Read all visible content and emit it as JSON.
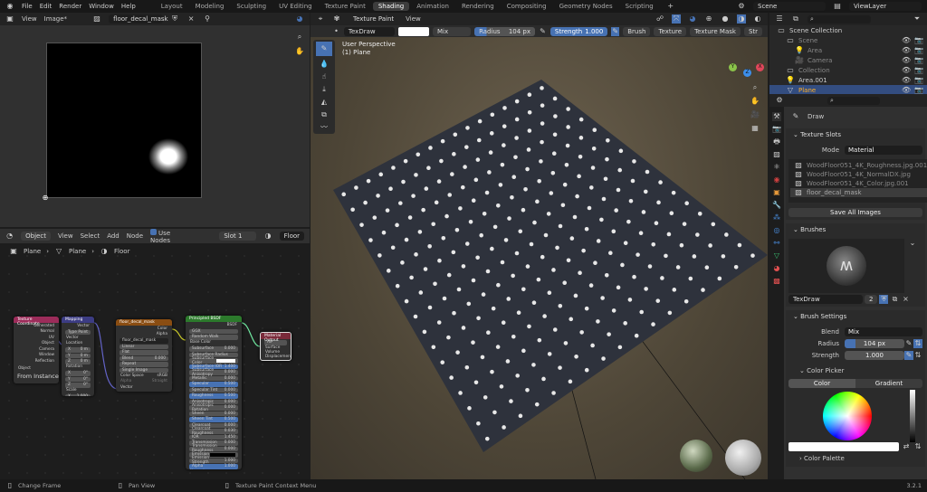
{
  "menu": {
    "items": [
      "File",
      "Edit",
      "Render",
      "Window",
      "Help"
    ]
  },
  "workspaces": [
    "Layout",
    "Modeling",
    "Sculpting",
    "UV Editing",
    "Texture Paint",
    "Shading",
    "Animation",
    "Rendering",
    "Compositing",
    "Geometry Nodes",
    "Scripting"
  ],
  "active_workspace": "Shading",
  "scene": "Scene",
  "view_layer": "ViewLayer",
  "image_editor": {
    "view": "View",
    "image_menu": "Image*",
    "image_name": "floor_decal_mask"
  },
  "viewport": {
    "mode": "Texture Paint",
    "view": "View",
    "brush_name": "TexDraw",
    "blend": "Mix",
    "radius_label": "Radius",
    "radius": "104 px",
    "radius_fraction": 0.2,
    "strength_label": "Strength",
    "strength": "1.000",
    "menus": [
      "Brush",
      "Texture",
      "Texture Mask",
      "Str"
    ],
    "perspective": "User Perspective",
    "object": "(1) Plane",
    "axes": {
      "x": "X",
      "y": "Y",
      "z": "Z"
    }
  },
  "node_editor": {
    "object_mode": "Object",
    "menus": [
      "View",
      "Select",
      "Add",
      "Node"
    ],
    "use_nodes": "Use Nodes",
    "slot": "Slot 1",
    "material": "Floor",
    "breadcrumb": [
      "Plane",
      "Plane",
      "Floor"
    ],
    "nodes": {
      "texcoord": {
        "title": "Texture Coordinate",
        "outputs": [
          "Generated",
          "Normal",
          "UV",
          "Object",
          "Camera",
          "Window",
          "Reflection"
        ],
        "object_label": "Object",
        "from_instancer": "From Instancer"
      },
      "mapping": {
        "title": "Mapping",
        "output": "Vector",
        "type_label": "Type",
        "type": "Point",
        "input": "Vector",
        "location": "Location",
        "rotation": "Rotation",
        "scale": "Scale",
        "loc": [
          "0 m",
          "0 m",
          "0 m"
        ],
        "rot": [
          "0°",
          "0°",
          "0°"
        ],
        "scl": [
          "1.000",
          "1.000",
          "1.000"
        ],
        "axes": [
          "X",
          "Y",
          "Z"
        ]
      },
      "image": {
        "title": "floor_decal_mask",
        "outputs": [
          "Color",
          "Alpha"
        ],
        "image": "floor_decal_mask",
        "interpolation": "Linear",
        "projection": "Flat",
        "blend_label": "Blend",
        "blend": "0.000",
        "extension": "Repeat",
        "source": "Single Image",
        "colorspace_label": "Color Space",
        "colorspace": "sRGB",
        "alpha_label": "Alpha",
        "alpha": "Straight",
        "input": "Vector"
      },
      "bsdf": {
        "title": "Principled BSDF",
        "output": "BSDF",
        "dist": "GGX",
        "sss": "Random Walk",
        "base_color": "Base Color",
        "fields": [
          [
            "Subsurface",
            "0.000",
            0
          ],
          [
            "Subsurface Radius",
            "",
            0
          ],
          [
            "Subsurface Color",
            "",
            0
          ],
          [
            "Subsurface IOR",
            "1.400",
            1
          ],
          [
            "Subsurface Anisotropy",
            "0.000",
            0
          ],
          [
            "Metallic",
            "0.000",
            0
          ],
          [
            "Specular",
            "0.500",
            1
          ],
          [
            "Specular Tint",
            "0.000",
            0
          ],
          [
            "Roughness",
            "0.500",
            1
          ],
          [
            "Anisotropic",
            "0.000",
            0
          ],
          [
            "Anisotropic Rotation",
            "0.000",
            0
          ],
          [
            "Sheen",
            "0.000",
            0
          ],
          [
            "Sheen Tint",
            "0.500",
            1
          ],
          [
            "Clearcoat",
            "0.000",
            0
          ],
          [
            "Clearcoat Roughness",
            "0.030",
            0
          ],
          [
            "IOR",
            "1.450",
            0
          ],
          [
            "Transmission",
            "0.000",
            0
          ],
          [
            "Transmission Roughness",
            "0.000",
            0
          ],
          [
            "Emission",
            "",
            0
          ],
          [
            "Emission Strength",
            "1.000",
            0
          ],
          [
            "Alpha",
            "1.000",
            1
          ]
        ],
        "vectors": [
          "Normal",
          "Clearcoat Normal",
          "Tangent"
        ]
      },
      "output": {
        "title": "Material Output",
        "target": "All",
        "inputs": [
          "Surface",
          "Volume",
          "Displacement"
        ]
      }
    }
  },
  "outliner": {
    "root": "Scene Collection",
    "items": [
      {
        "name": "Scene",
        "depth": 1
      },
      {
        "name": "Area",
        "depth": 2
      },
      {
        "name": "Camera",
        "depth": 2
      },
      {
        "name": "Collection",
        "depth": 1
      },
      {
        "name": "Area.001",
        "depth": 1
      },
      {
        "name": "Plane",
        "depth": 1,
        "selected": true
      }
    ]
  },
  "properties": {
    "tool": "Draw",
    "texture_slots": {
      "title": "Texture Slots",
      "mode_label": "Mode",
      "mode": "Material",
      "slots": [
        "WoodFloor051_4K_Roughness.jpg.001",
        "WoodFloor051_4K_NormalDX.jpg",
        "WoodFloor051_4K_Color.jpg.001",
        "floor_decal_mask"
      ],
      "active": 3,
      "save_all": "Save All Images"
    },
    "brushes": {
      "title": "Brushes",
      "name": "TexDraw",
      "users": "2"
    },
    "brush_settings": {
      "title": "Brush Settings",
      "blend_label": "Blend",
      "blend": "Mix",
      "radius_label": "Radius",
      "radius": "104 px",
      "strength_label": "Strength",
      "strength": "1.000"
    },
    "color_picker": {
      "title": "Color Picker",
      "tabs": [
        "Color",
        "Gradient"
      ],
      "active": "Color",
      "color": "#ffffff"
    },
    "color_palette": "Color Palette"
  },
  "status": {
    "items": [
      "Change Frame",
      "Pan View",
      "Texture Paint Context Menu"
    ],
    "version": "3.2.1"
  },
  "colors": {
    "accent": "#4772b3",
    "selected_row": "#334d80",
    "header": "#232323"
  }
}
